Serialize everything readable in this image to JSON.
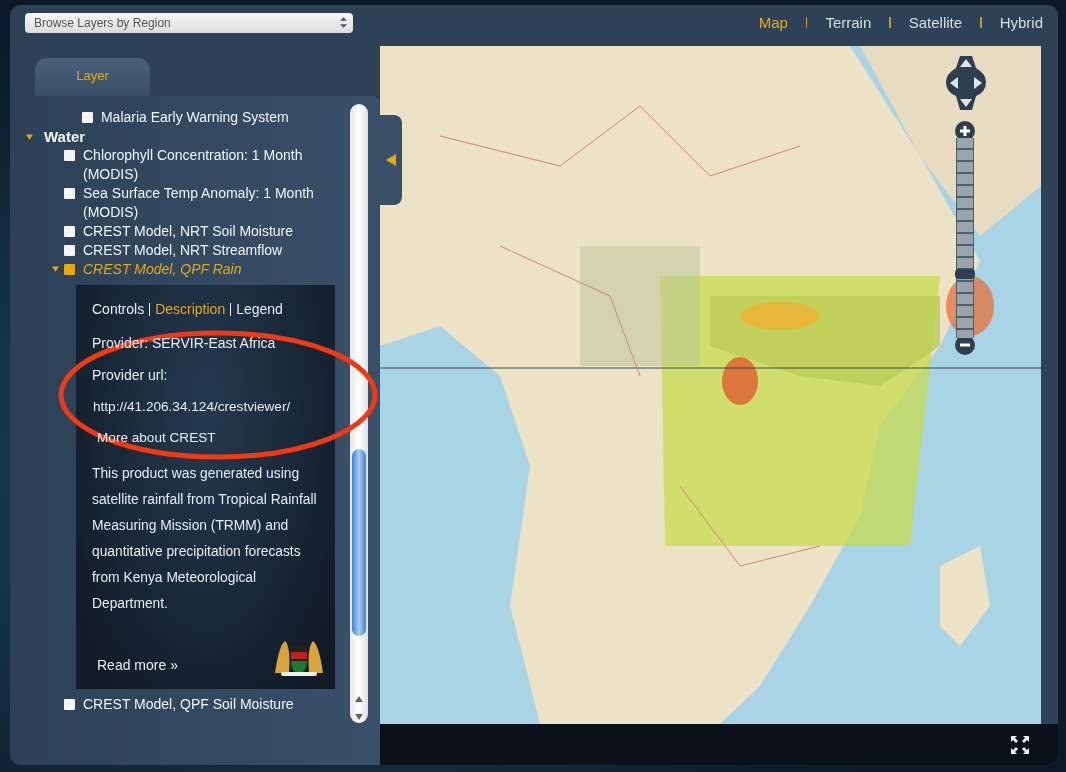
{
  "region_select": {
    "value": "Browse Layers by Region"
  },
  "map_types": [
    {
      "label": "Map",
      "selected": true
    },
    {
      "label": "Terrain",
      "selected": false
    },
    {
      "label": "Satellite",
      "selected": false
    },
    {
      "label": "Hybrid",
      "selected": false
    }
  ],
  "panel_tab": {
    "label": "Layer",
    "selected": true
  },
  "layer_tree": [
    {
      "kind": "layer",
      "label": "Malaria Early Warning System",
      "checked": false,
      "expanded": false
    },
    {
      "kind": "group",
      "label": "Water",
      "expanded": true,
      "children": [
        {
          "kind": "layer",
          "label": "Chlorophyll Concentration: 1 Month (MODIS)",
          "checked": false,
          "expanded": false
        },
        {
          "kind": "layer",
          "label": "Sea Surface Temp Anomaly: 1 Month (MODIS)",
          "checked": false,
          "expanded": false
        },
        {
          "kind": "layer",
          "label": "CREST Model, NRT Soil Moisture",
          "checked": false,
          "expanded": false
        },
        {
          "kind": "layer",
          "label": "CREST Model, NRT Streamflow",
          "checked": false,
          "expanded": false
        },
        {
          "kind": "layer",
          "label": "CREST Model, QPF Rain",
          "checked": true,
          "expanded": true,
          "details": {
            "tabs": [
              {
                "label": "Controls",
                "selected": false
              },
              {
                "label": "Description",
                "selected": true
              },
              {
                "label": "Legend",
                "selected": false
              }
            ],
            "provider": "Provider: SERVIR-East Africa",
            "provider_url_label": "Provider url:",
            "provider_url": "http://41.206.34.124/crestviewer/",
            "more_link": "More about CREST",
            "description": "This product was generated using satellite rainfall from Tropical Rainfall Measuring Mission (TRMM) and quantitative precipitation forecasts from Kenya Meteorological Department.",
            "read_more": "Read more »"
          }
        },
        {
          "kind": "layer",
          "label": "CREST Model, QPF Soil Moisture",
          "checked": false,
          "expanded": false
        }
      ]
    }
  ],
  "zoom_slider": {
    "level": 0.32
  }
}
